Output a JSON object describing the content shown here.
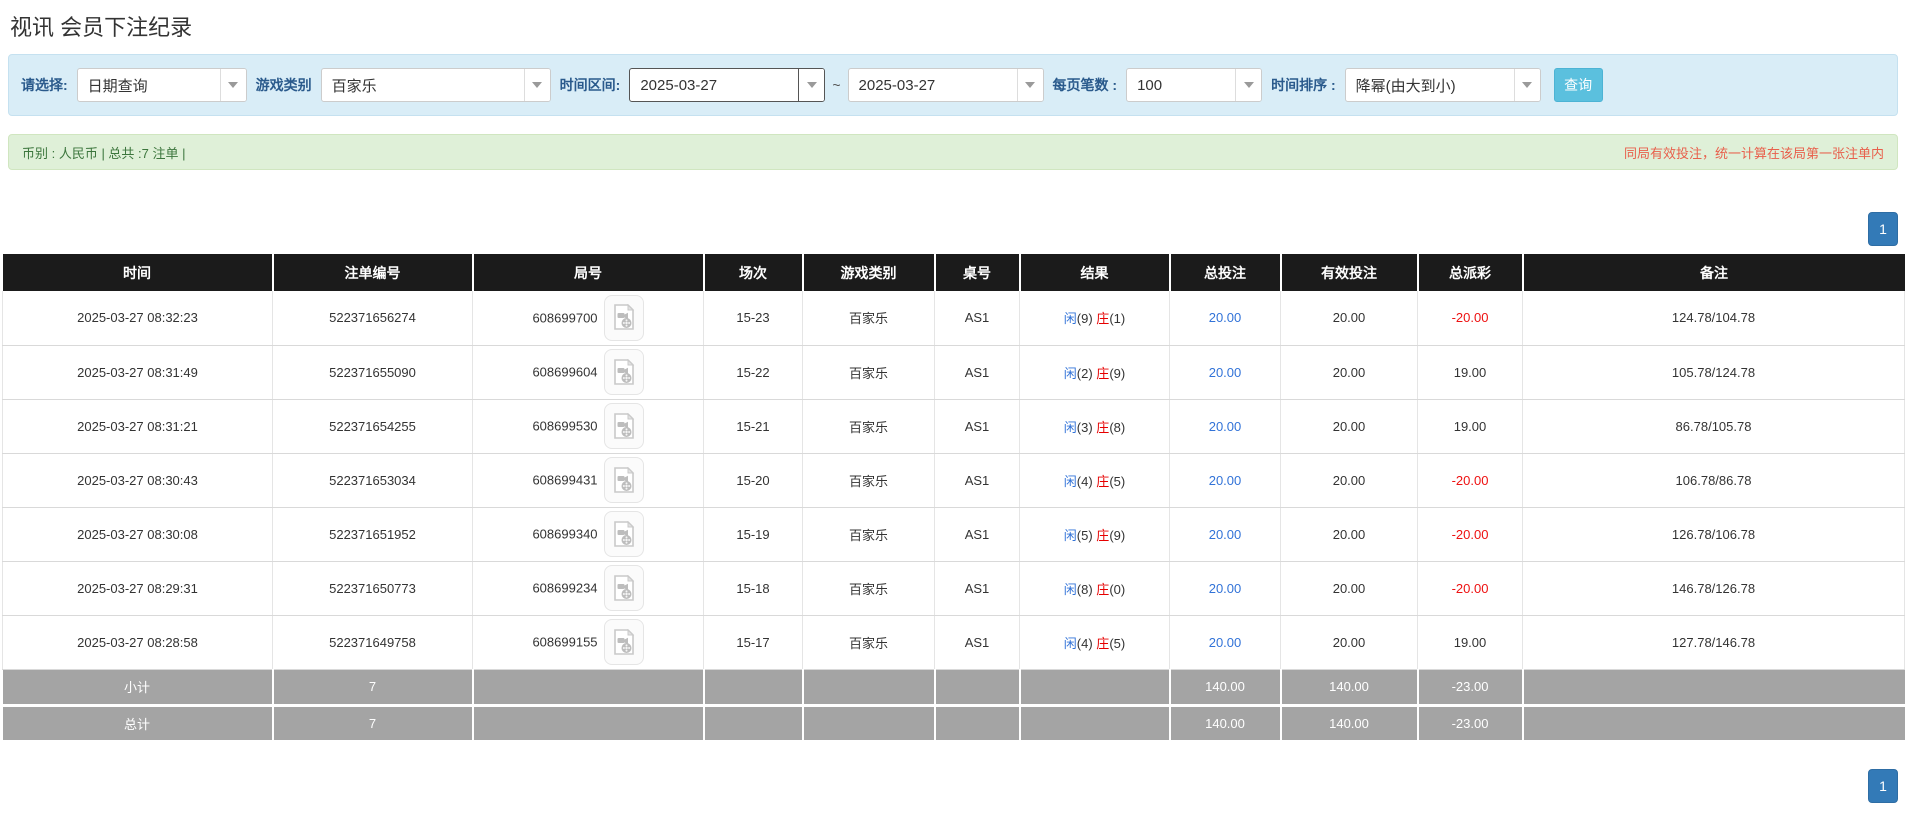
{
  "page": {
    "title": "视讯 会员下注纪录"
  },
  "filters": {
    "select_label": "请选择:",
    "select_value": "日期查询",
    "game_type_label": "游戏类别",
    "game_type_value": "百家乐",
    "date_range_label": "时间区间:",
    "date_from": "2025-03-27",
    "date_separator": "~",
    "date_to": "2025-03-27",
    "page_size_label": "每页笔数 :",
    "page_size_value": "100",
    "sort_label": "时间排序 :",
    "sort_value": "降幂(由大到小)",
    "query_button": "查询"
  },
  "summary": {
    "left_text": "币别 : 人民币 | 总共 :7 注单 |",
    "right_text": "同局有效投注，统一计算在该局第一张注单内"
  },
  "pagination": {
    "page": "1"
  },
  "colors": {
    "accent_blue": "#3273d8",
    "accent_red": "#ee1111",
    "header_bg": "#1b1b1b",
    "footer_bg": "#a4a4a4",
    "filter_bg": "#d9edf7",
    "summary_bg": "#dff0d8",
    "query_button_bg": "#5bc0de",
    "page_button_bg": "#337ab7"
  },
  "icons": {
    "video_record": "video-file-icon",
    "dropdown": "chevron-down-icon"
  },
  "table": {
    "headers": [
      "时间",
      "注单编号",
      "局号",
      "场次",
      "游戏类别",
      "桌号",
      "结果",
      "总投注",
      "有效投注",
      "总派彩",
      "备注"
    ],
    "rows": [
      {
        "time": "2025-03-27 08:32:23",
        "bet_id": "522371656274",
        "round_id": "608699700",
        "session": "15-23",
        "game": "百家乐",
        "table_no": "AS1",
        "result_player": "闲",
        "result_player_num": "(9)",
        "result_banker": "庄",
        "result_banker_num": "(1)",
        "total_bet": "20.00",
        "valid_bet": "20.00",
        "payout": "-20.00",
        "remark": "124.78/104.78"
      },
      {
        "time": "2025-03-27 08:31:49",
        "bet_id": "522371655090",
        "round_id": "608699604",
        "session": "15-22",
        "game": "百家乐",
        "table_no": "AS1",
        "result_player": "闲",
        "result_player_num": "(2)",
        "result_banker": "庄",
        "result_banker_num": "(9)",
        "total_bet": "20.00",
        "valid_bet": "20.00",
        "payout": "19.00",
        "remark": "105.78/124.78"
      },
      {
        "time": "2025-03-27 08:31:21",
        "bet_id": "522371654255",
        "round_id": "608699530",
        "session": "15-21",
        "game": "百家乐",
        "table_no": "AS1",
        "result_player": "闲",
        "result_player_num": "(3)",
        "result_banker": "庄",
        "result_banker_num": "(8)",
        "total_bet": "20.00",
        "valid_bet": "20.00",
        "payout": "19.00",
        "remark": "86.78/105.78"
      },
      {
        "time": "2025-03-27 08:30:43",
        "bet_id": "522371653034",
        "round_id": "608699431",
        "session": "15-20",
        "game": "百家乐",
        "table_no": "AS1",
        "result_player": "闲",
        "result_player_num": "(4)",
        "result_banker": "庄",
        "result_banker_num": "(5)",
        "total_bet": "20.00",
        "valid_bet": "20.00",
        "payout": "-20.00",
        "remark": "106.78/86.78"
      },
      {
        "time": "2025-03-27 08:30:08",
        "bet_id": "522371651952",
        "round_id": "608699340",
        "session": "15-19",
        "game": "百家乐",
        "table_no": "AS1",
        "result_player": "闲",
        "result_player_num": "(5)",
        "result_banker": "庄",
        "result_banker_num": "(9)",
        "total_bet": "20.00",
        "valid_bet": "20.00",
        "payout": "-20.00",
        "remark": "126.78/106.78"
      },
      {
        "time": "2025-03-27 08:29:31",
        "bet_id": "522371650773",
        "round_id": "608699234",
        "session": "15-18",
        "game": "百家乐",
        "table_no": "AS1",
        "result_player": "闲",
        "result_player_num": "(8)",
        "result_banker": "庄",
        "result_banker_num": "(0)",
        "total_bet": "20.00",
        "valid_bet": "20.00",
        "payout": "-20.00",
        "remark": "146.78/126.78"
      },
      {
        "time": "2025-03-27 08:28:58",
        "bet_id": "522371649758",
        "round_id": "608699155",
        "session": "15-17",
        "game": "百家乐",
        "table_no": "AS1",
        "result_player": "闲",
        "result_player_num": "(4)",
        "result_banker": "庄",
        "result_banker_num": "(5)",
        "total_bet": "20.00",
        "valid_bet": "20.00",
        "payout": "19.00",
        "remark": "127.78/146.78"
      }
    ],
    "footer_rows": [
      {
        "label": "小计",
        "count": "7",
        "total_bet": "140.00",
        "valid_bet": "140.00",
        "payout": "-23.00"
      },
      {
        "label": "总计",
        "count": "7",
        "total_bet": "140.00",
        "valid_bet": "140.00",
        "payout": "-23.00"
      }
    ]
  }
}
